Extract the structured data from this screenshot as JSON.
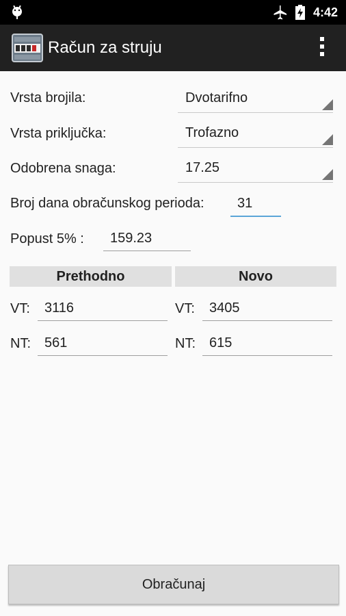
{
  "status_bar": {
    "time": "4:42"
  },
  "app_bar": {
    "title": "Račun za struju"
  },
  "form": {
    "meter_type": {
      "label": "Vrsta brojila:",
      "value": "Dvotarifno"
    },
    "connection_type": {
      "label": "Vrsta priključka:",
      "value": "Trofazno"
    },
    "approved_power": {
      "label": "Odobrena snaga:",
      "value": "17.25"
    },
    "billing_days": {
      "label": "Broj dana obračunskog perioda:",
      "value": "31"
    },
    "discount": {
      "label": "Popust 5% :",
      "value": "159.23"
    }
  },
  "readings": {
    "previous_header": "Prethodno",
    "new_header": "Novo",
    "vt_label": "VT:",
    "nt_label": "NT:",
    "previous": {
      "vt": "3116",
      "nt": "561"
    },
    "new": {
      "vt": "3405",
      "nt": "615"
    }
  },
  "actions": {
    "calculate_label": "Obračunaj"
  }
}
